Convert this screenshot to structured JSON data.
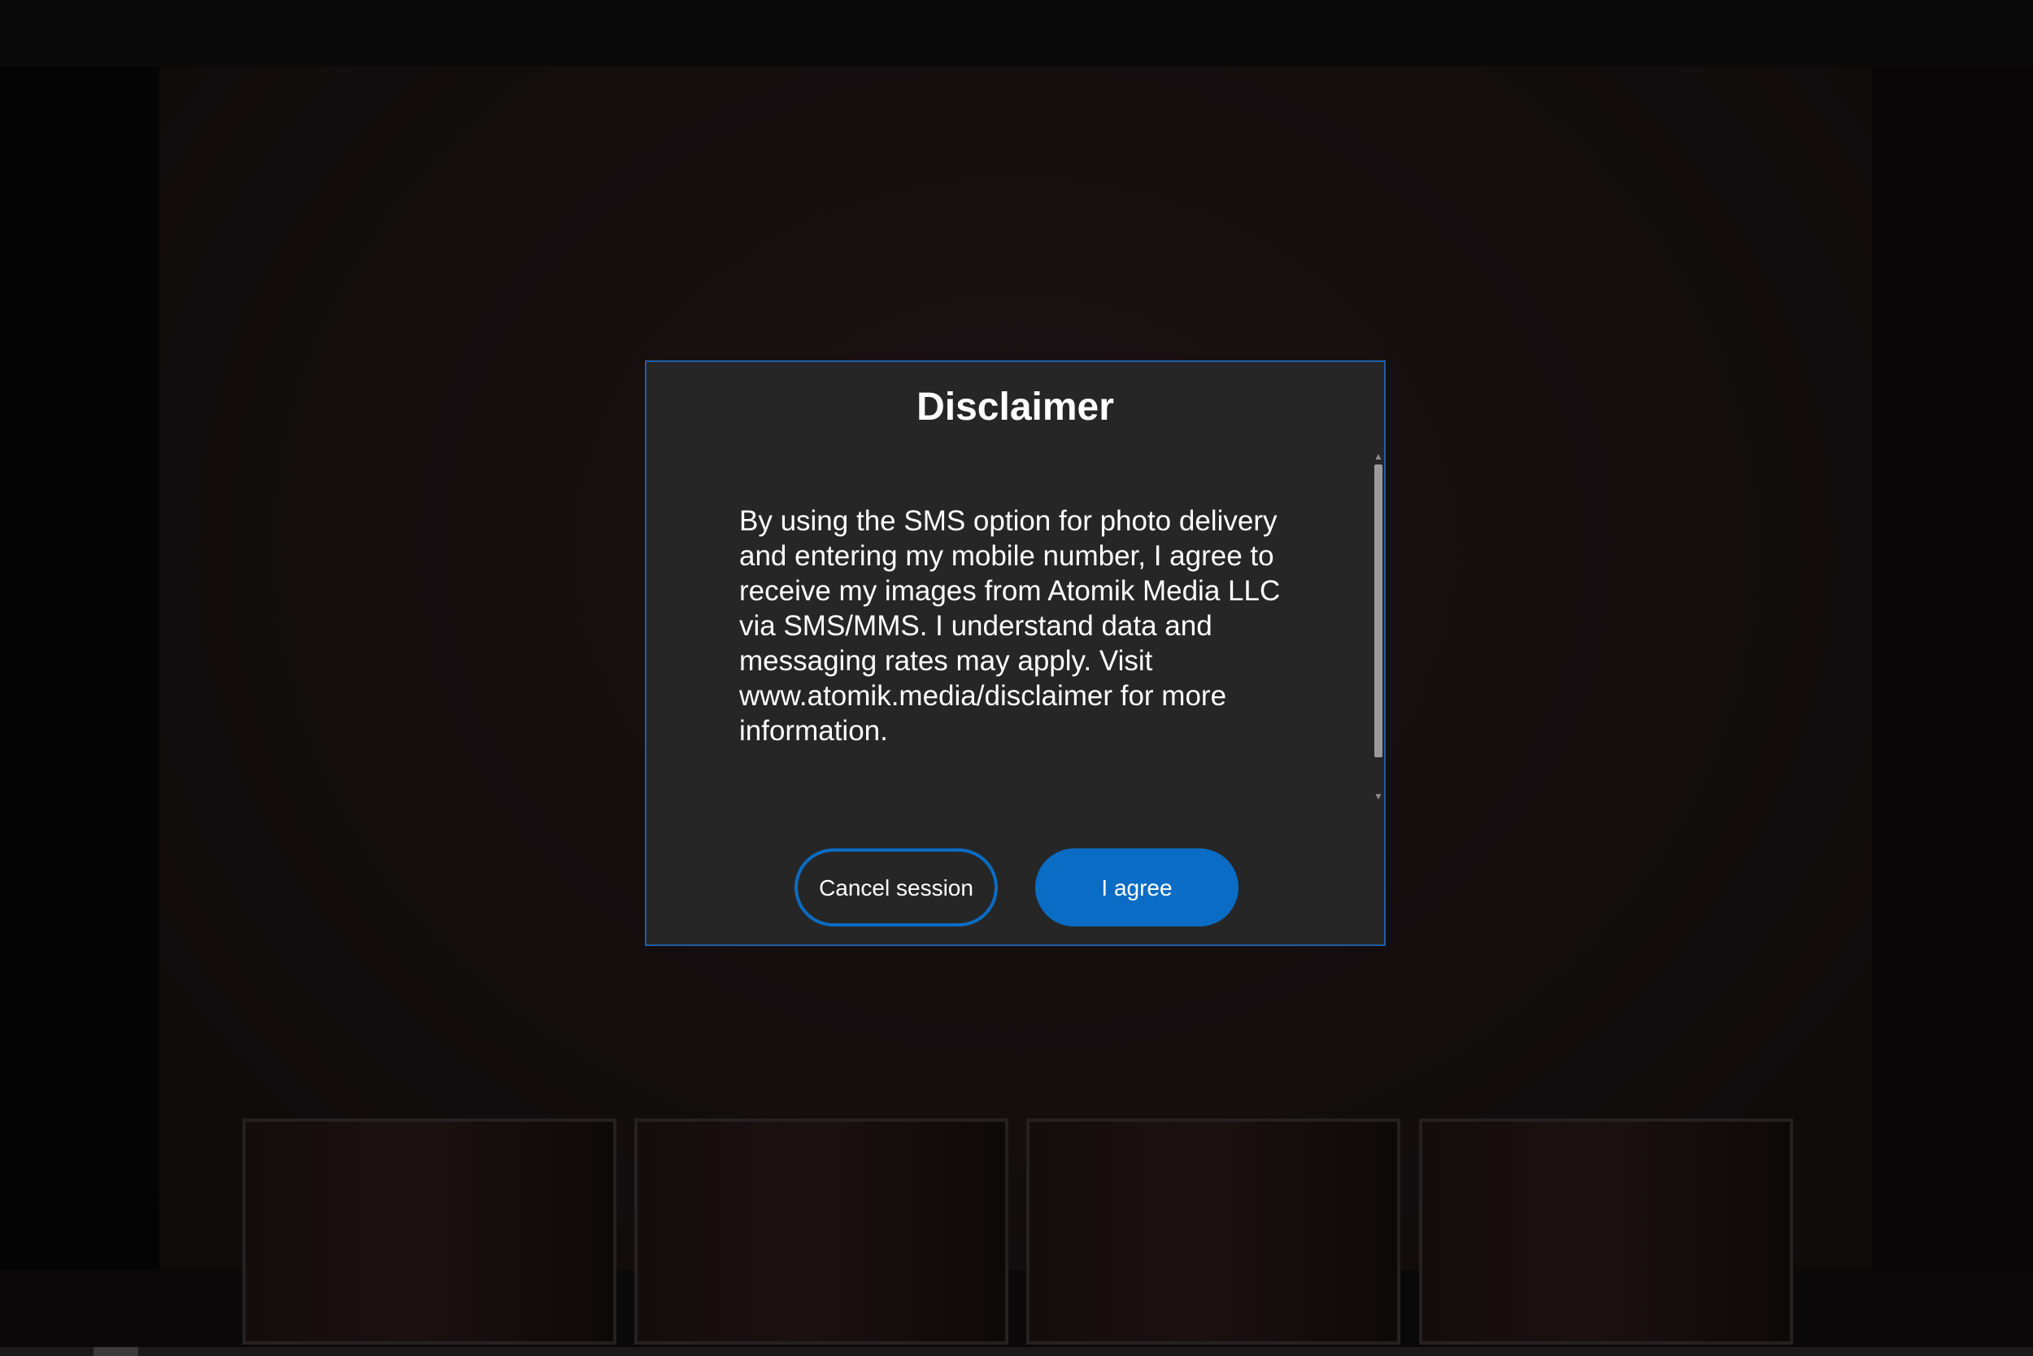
{
  "dialog": {
    "title": "Disclaimer",
    "body": "By using the SMS option for photo delivery and entering my mobile number, I agree to receive my images from Atomik Media LLC via SMS/MMS. I understand data and messaging rates may apply. Visit www.atomik.media/disclaimer for more information.",
    "cancel_label": "Cancel session",
    "agree_label": "I agree"
  },
  "scrollbar": {
    "up_icon": "caret-up-icon",
    "down_icon": "caret-down-icon"
  },
  "thumbnails": [
    {
      "name": "thumbnail-1"
    },
    {
      "name": "thumbnail-2"
    },
    {
      "name": "thumbnail-3"
    },
    {
      "name": "thumbnail-4"
    }
  ],
  "colors": {
    "accent": "#0a6cc4",
    "dialog_bg": "#262626",
    "dialog_border": "#1f5ea8",
    "text": "#ffffff"
  }
}
